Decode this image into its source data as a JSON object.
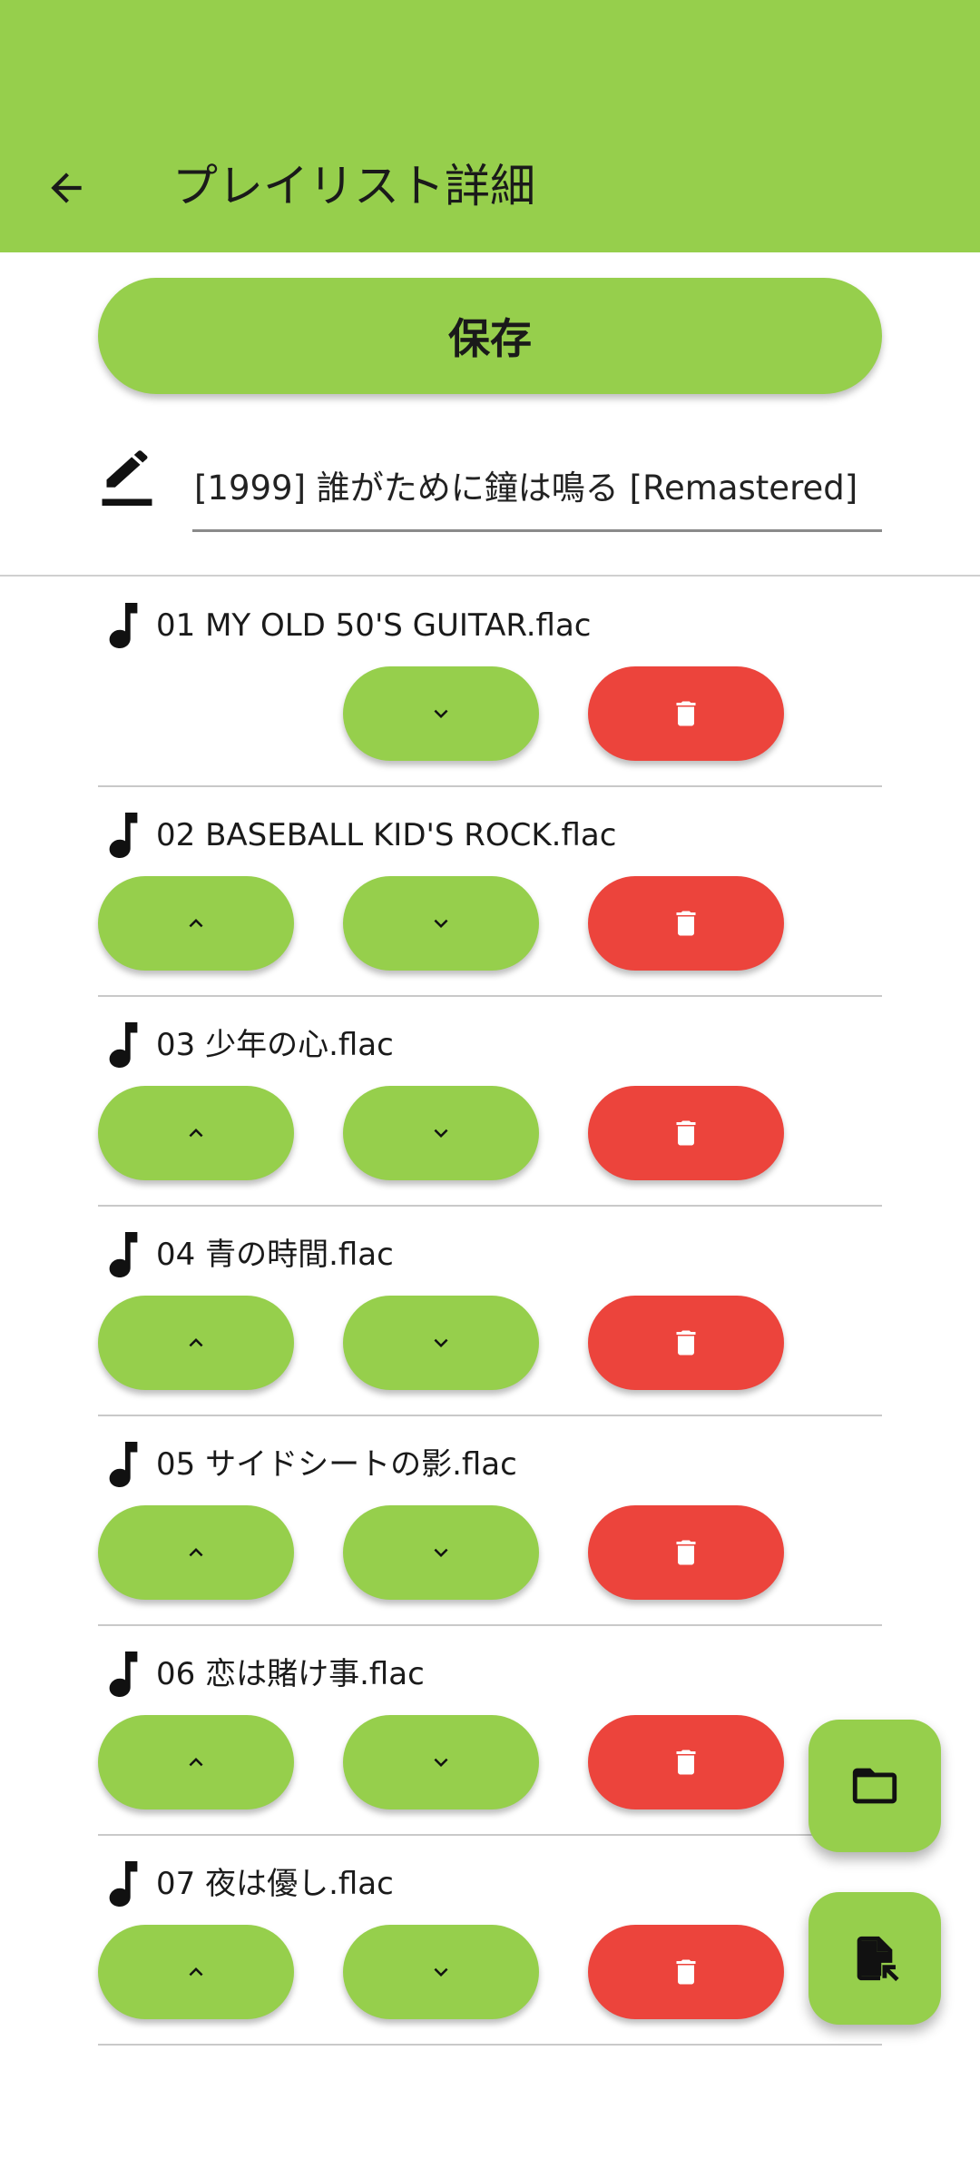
{
  "app_bar": {
    "title": "プレイリスト詳細",
    "back_icon": "arrow-back-icon",
    "color": "#96cf4c"
  },
  "save_button": {
    "label": "保存"
  },
  "playlist_name": {
    "value": "[1999] 誰がために鐘は鳴る [Remastered]",
    "icon": "edit-icon"
  },
  "tracks": [
    {
      "name": "01 MY OLD 50'S GUITAR.flac",
      "show_up": false
    },
    {
      "name": "02 BASEBALL KID'S ROCK.flac",
      "show_up": true
    },
    {
      "name": "03 少年の心.flac",
      "show_up": true
    },
    {
      "name": "04 青の時間.flac",
      "show_up": true
    },
    {
      "name": "05 サイドシートの影.flac",
      "show_up": true
    },
    {
      "name": "06 恋は賭け事.flac",
      "show_up": true
    },
    {
      "name": "07 夜は優し.flac",
      "show_up": true
    }
  ],
  "track_buttons": {
    "up_icon": "chevron-up-icon",
    "down_icon": "chevron-down-icon",
    "delete_icon": "trash-icon",
    "accent": "#96cf4c",
    "danger": "#ec443c"
  },
  "fabs": [
    {
      "icon": "folder-icon"
    },
    {
      "icon": "file-import-icon"
    }
  ]
}
